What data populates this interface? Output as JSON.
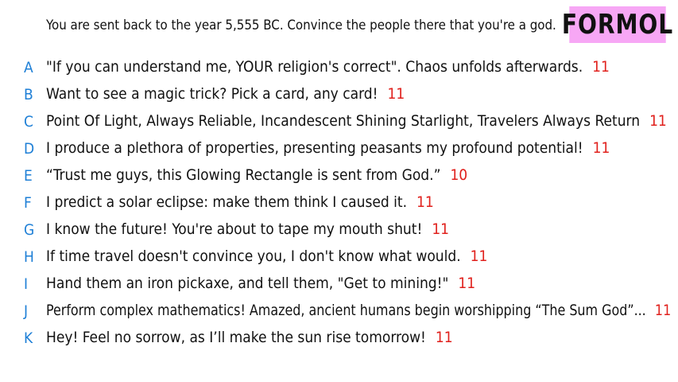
{
  "prompt": "You are sent back to the year 5,555 BC. Convince the people there that you're a god.",
  "logo": "FORMOL",
  "colors": {
    "letter": "#1e7fd6",
    "score": "#e0201c",
    "logo_bg": "#f7a7f5",
    "text": "#111111"
  },
  "answers": [
    {
      "letter": "A",
      "text": "\"If you can understand me, YOUR religion's correct\". Chaos unfolds afterwards.",
      "score": "11"
    },
    {
      "letter": "B",
      "text": "Want to see a magic trick? Pick a card, any card!",
      "score": "11"
    },
    {
      "letter": "C",
      "text": "Point Of Light, Always Reliable, Incandescent Shining Starlight, Travelers Always Return",
      "score": "11"
    },
    {
      "letter": "D",
      "text": "I produce a plethora of properties, presenting peasants my profound potential!",
      "score": "11"
    },
    {
      "letter": "E",
      "text": "“Trust me guys, this Glowing Rectangle is sent from God.”",
      "score": "10"
    },
    {
      "letter": "F",
      "text": "I predict a solar eclipse: make them think I caused it.",
      "score": "11"
    },
    {
      "letter": "G",
      "text": "I know the future! You're about to tape my mouth shut!",
      "score": "11"
    },
    {
      "letter": "H",
      "text": "If time travel doesn't convince you, I don't know what would.",
      "score": "11"
    },
    {
      "letter": "I",
      "text": "Hand them an iron pickaxe, and tell them, \"Get to mining!\"",
      "score": "11"
    },
    {
      "letter": "J",
      "text": "Perform complex mathematics! Amazed, ancient humans begin worshipping “The Sum God”...",
      "score": "11"
    },
    {
      "letter": "K",
      "text": "Hey! Feel no sorrow, as I’ll make the sun rise tomorrow!",
      "score": "11"
    }
  ]
}
